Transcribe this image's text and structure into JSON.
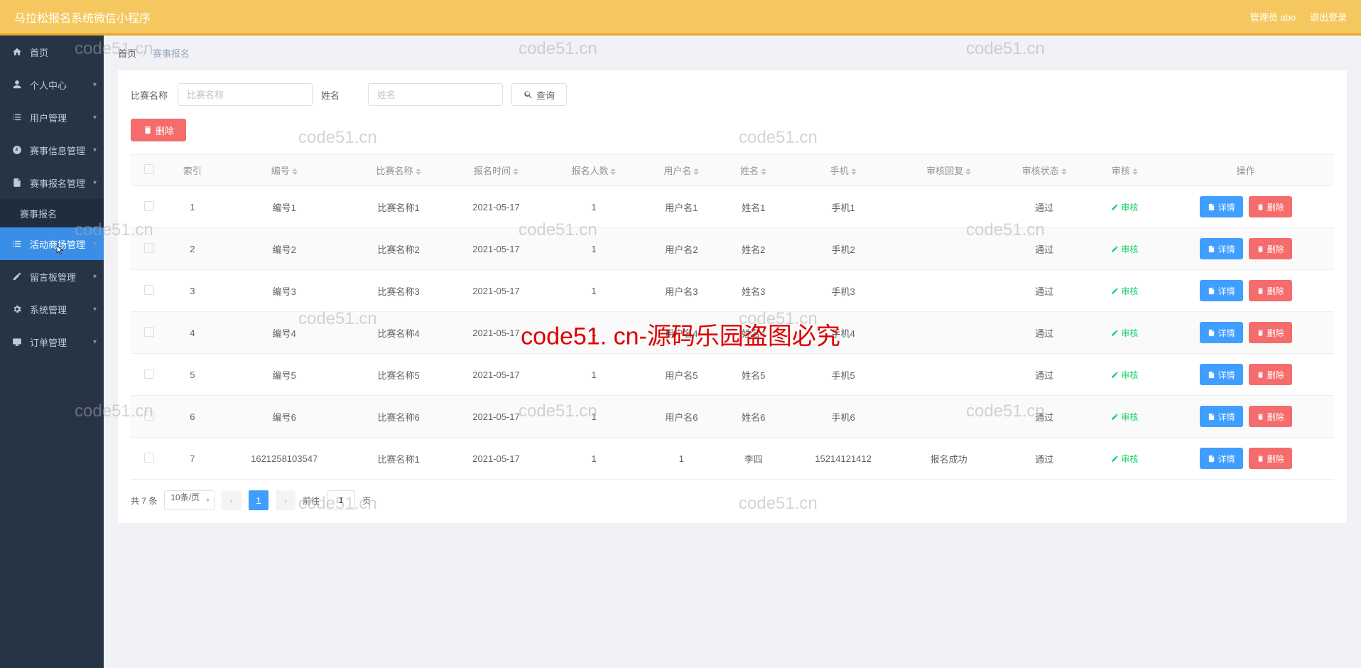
{
  "header": {
    "title": "马拉松报名系统微信小程序",
    "admin": "管理员 abo",
    "logout": "退出登录"
  },
  "sidebar": {
    "items": [
      {
        "icon": "home",
        "label": "首页"
      },
      {
        "icon": "user",
        "label": "个人中心",
        "expand": true
      },
      {
        "icon": "list",
        "label": "用户管理",
        "expand": true
      },
      {
        "icon": "clock",
        "label": "赛事信息管理",
        "expand": true
      },
      {
        "icon": "doc",
        "label": "赛事报名管理",
        "expand": true
      },
      {
        "icon": "list",
        "label": "活动商场管理",
        "highlight": true,
        "expand": true
      },
      {
        "icon": "edit",
        "label": "留言板管理",
        "expand": true
      },
      {
        "icon": "gear",
        "label": "系统管理",
        "expand": true
      },
      {
        "icon": "monitor",
        "label": "订单管理",
        "expand": true
      }
    ],
    "submenu": {
      "label": "赛事报名"
    }
  },
  "breadcrumb": {
    "home": "首页",
    "current": "赛事报名"
  },
  "filter": {
    "label1": "比赛名称",
    "ph1": "比赛名称",
    "label2": "姓名",
    "ph2": "姓名",
    "query": "查询"
  },
  "toolbar": {
    "delete": "删除"
  },
  "table": {
    "headers": [
      "索引",
      "编号",
      "比赛名称",
      "报名时间",
      "报名人数",
      "用户名",
      "姓名",
      "手机",
      "审核回复",
      "审核状态",
      "审核",
      "操作"
    ],
    "auditBtn": "审核",
    "detailBtn": "详情",
    "deleteBtn": "删除",
    "rows": [
      {
        "idx": "1",
        "code": "编号1",
        "name": "比赛名称1",
        "date": "2021-05-17",
        "count": "1",
        "user": "用户名1",
        "realname": "姓名1",
        "phone": "手机1",
        "reply": "",
        "status": "通过"
      },
      {
        "idx": "2",
        "code": "编号2",
        "name": "比赛名称2",
        "date": "2021-05-17",
        "count": "1",
        "user": "用户名2",
        "realname": "姓名2",
        "phone": "手机2",
        "reply": "",
        "status": "通过"
      },
      {
        "idx": "3",
        "code": "编号3",
        "name": "比赛名称3",
        "date": "2021-05-17",
        "count": "1",
        "user": "用户名3",
        "realname": "姓名3",
        "phone": "手机3",
        "reply": "",
        "status": "通过"
      },
      {
        "idx": "4",
        "code": "编号4",
        "name": "比赛名称4",
        "date": "2021-05-17",
        "count": "1",
        "user": "用户名4",
        "realname": "姓名4",
        "phone": "手机4",
        "reply": "",
        "status": "通过"
      },
      {
        "idx": "5",
        "code": "编号5",
        "name": "比赛名称5",
        "date": "2021-05-17",
        "count": "1",
        "user": "用户名5",
        "realname": "姓名5",
        "phone": "手机5",
        "reply": "",
        "status": "通过"
      },
      {
        "idx": "6",
        "code": "编号6",
        "name": "比赛名称6",
        "date": "2021-05-17",
        "count": "1",
        "user": "用户名6",
        "realname": "姓名6",
        "phone": "手机6",
        "reply": "",
        "status": "通过"
      },
      {
        "idx": "7",
        "code": "1621258103547",
        "name": "比赛名称1",
        "date": "2021-05-17",
        "count": "1",
        "user": "1",
        "realname": "李四",
        "phone": "15214121412",
        "reply": "报名成功",
        "status": "通过"
      }
    ]
  },
  "pagination": {
    "total": "共 7 条",
    "pageSize": "10条/页",
    "current": "1",
    "goto": "前往",
    "page": "页",
    "pageInput": "1"
  },
  "watermarks": {
    "text": "code51.cn",
    "center": "code51. cn-源码乐园盗图必究"
  }
}
